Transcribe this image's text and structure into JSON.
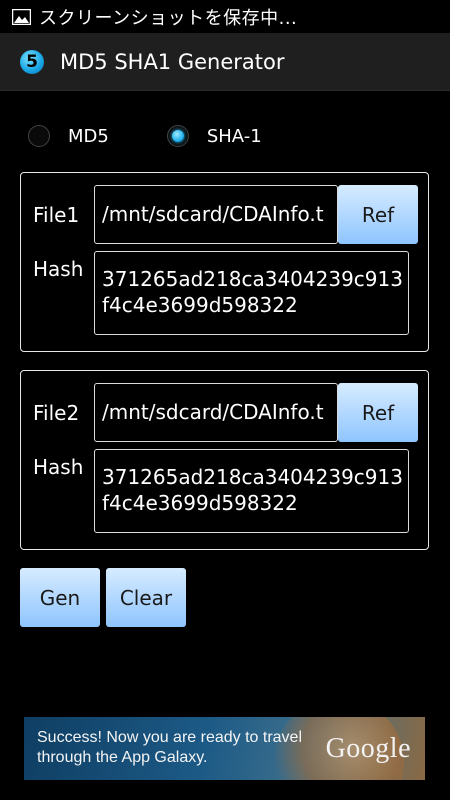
{
  "status_bar": {
    "notification_text": "スクリーンショットを保存中..."
  },
  "title_bar": {
    "app_icon_glyph": "5",
    "title": "MD5 SHA1 Generator"
  },
  "hash_type": {
    "options": [
      {
        "label": "MD5",
        "selected": false
      },
      {
        "label": "SHA-1",
        "selected": true
      }
    ]
  },
  "file1": {
    "label": "File1",
    "path": "/mnt/sdcard/CDAInfo.t",
    "ref_label": "Ref",
    "hash_label": "Hash",
    "hash": "371265ad218ca3404239c913f4c4e3699d598322"
  },
  "file2": {
    "label": "File2",
    "path": "/mnt/sdcard/CDAInfo.t",
    "ref_label": "Ref",
    "hash_label": "Hash",
    "hash": "371265ad218ca3404239c913f4c4e3699d598322"
  },
  "actions": {
    "gen_label": "Gen",
    "clear_label": "Clear"
  },
  "ad": {
    "text": "Success! Now you are ready to travel through the App Galaxy.",
    "brand": "Google"
  },
  "colors": {
    "accent": "#22b3ee",
    "button_blue": "#b6daff"
  }
}
